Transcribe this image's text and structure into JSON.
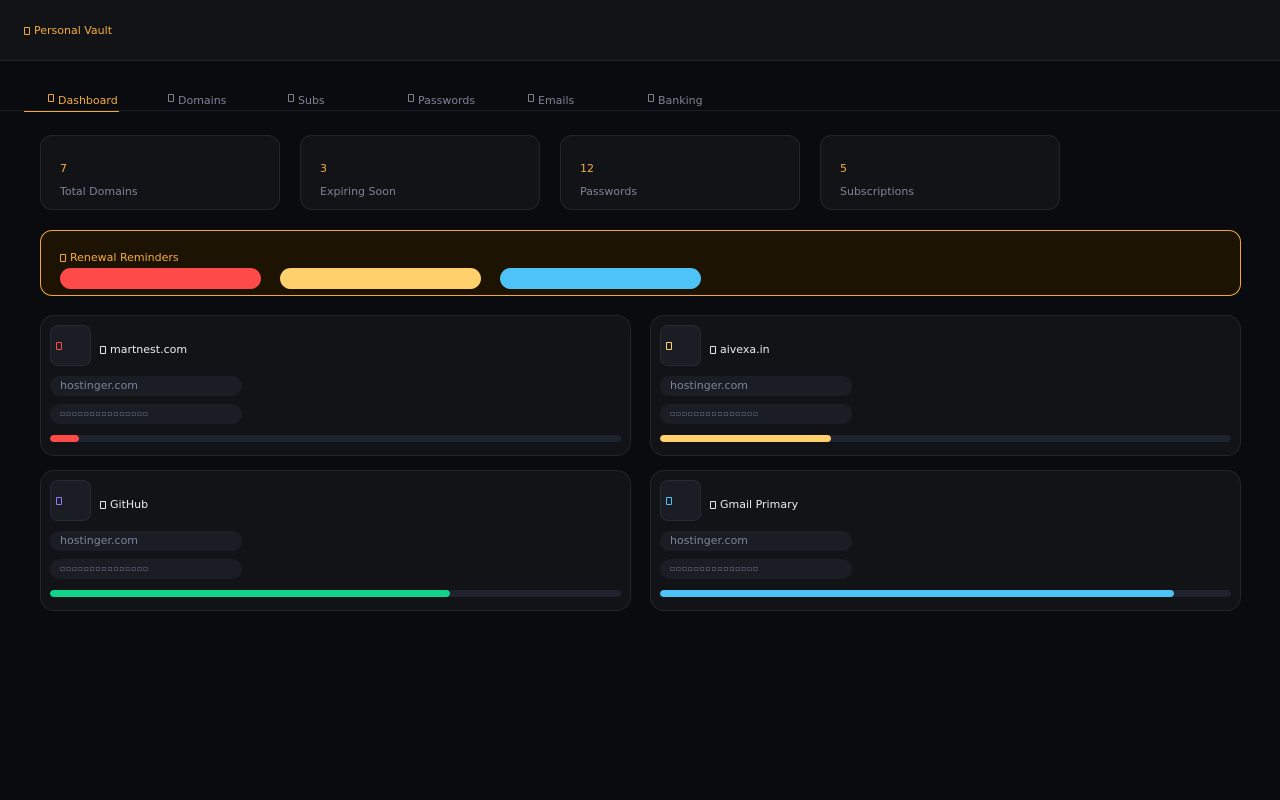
{
  "app": {
    "title": "Personal Vault",
    "icon": "vault-icon"
  },
  "nav": {
    "tabs": [
      {
        "label": "Dashboard",
        "icon": "dashboard-icon",
        "active": true
      },
      {
        "label": "Domains",
        "icon": "globe-icon"
      },
      {
        "label": "Subs",
        "icon": "refresh-icon"
      },
      {
        "label": "Passwords",
        "icon": "key-icon"
      },
      {
        "label": "Emails",
        "icon": "mail-icon"
      },
      {
        "label": "Banking",
        "icon": "bank-icon"
      }
    ]
  },
  "stats": [
    {
      "value": "7",
      "label": "Total Domains"
    },
    {
      "value": "3",
      "label": "Expiring Soon"
    },
    {
      "value": "12",
      "label": "Passwords"
    },
    {
      "value": "5",
      "label": "Subscriptions"
    }
  ],
  "reminders": {
    "title": "Renewal Reminders",
    "icon": "warning-icon",
    "colors": [
      "#ff4a4a",
      "#ffd06b",
      "#4dc3f7"
    ]
  },
  "cards": [
    {
      "name": "martnest.com",
      "host": "hostinger.com",
      "progress": 0.05,
      "color": "#ff4a4a",
      "icon": "globe-icon"
    },
    {
      "name": "aivexa.in",
      "host": "hostinger.com",
      "progress": 0.3,
      "color": "#ffd06b",
      "icon": "globe-icon"
    },
    {
      "name": "GitHub",
      "host": "hostinger.com",
      "progress": 0.7,
      "color": "#11d48a",
      "icon": "code-icon"
    },
    {
      "name": "Gmail Primary",
      "host": "hostinger.com",
      "progress": 0.9,
      "color": "#4dc3f7",
      "icon": "mail-icon"
    }
  ],
  "colors": {
    "accent": "#f2a93b",
    "bg": "#0a0b0e",
    "panel": "#121317"
  }
}
